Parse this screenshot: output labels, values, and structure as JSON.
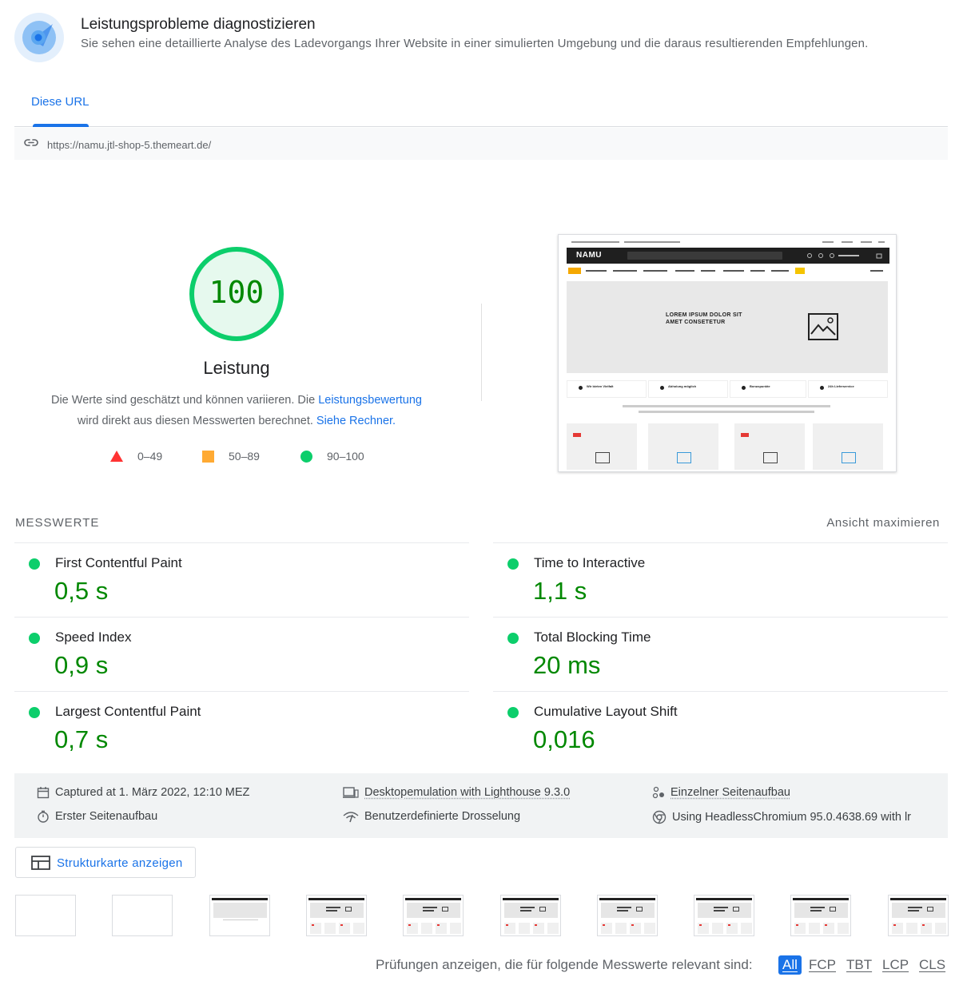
{
  "header": {
    "title": "Leistungsprobleme diagnostizieren",
    "description": "Sie sehen eine detaillierte Analyse des Ladevorgangs Ihrer Website in einer simulierten Umgebung und die daraus resultierenden Empfehlungen.",
    "icon": "lighthouse-gauge-icon"
  },
  "tabs": [
    {
      "label": "Diese URL",
      "active": true
    }
  ],
  "url_bar": {
    "icon": "link-icon",
    "url": "https://namu.jtl-shop-5.themeart.de/"
  },
  "score": {
    "value": "100",
    "fraction": 1.0,
    "label": "Leistung",
    "description_part1": "Die Werte sind geschätzt und können variieren. Die ",
    "description_link1": "Leistungsbewertung",
    "description_part2": "wird direkt aus diesen Messwerten berechnet. ",
    "description_link2": "Siehe Rechner.",
    "color": "#0cce6b",
    "text_color": "#008800"
  },
  "legend": [
    {
      "range": "0–49",
      "shape": "triangle",
      "color": "#ff3333"
    },
    {
      "range": "50–89",
      "shape": "square",
      "color": "#ffaa33"
    },
    {
      "range": "90–100",
      "shape": "circle",
      "color": "#0cce6b"
    }
  ],
  "screenshot": {
    "logo": "NAMU",
    "hero_line1": "LOREM IPSUM DOLOR SIT",
    "hero_line2": "AMET CONSETETUR",
    "features": [
      "Wir bieten Vielfalt",
      "Abholung möglich",
      "Bonuspunkte",
      "24h Lieferservice"
    ]
  },
  "metrics": {
    "title": "MESSWERTE",
    "toggle_label": "Ansicht maximieren",
    "items": [
      {
        "name": "First Contentful Paint",
        "value": "0,5 s",
        "status": "pass"
      },
      {
        "name": "Time to Interactive",
        "value": "1,1 s",
        "status": "pass"
      },
      {
        "name": "Speed Index",
        "value": "0,9 s",
        "status": "pass"
      },
      {
        "name": "Total Blocking Time",
        "value": "20 ms",
        "status": "pass"
      },
      {
        "name": "Largest Contentful Paint",
        "value": "0,7 s",
        "status": "pass"
      },
      {
        "name": "Cumulative Layout Shift",
        "value": "0,016",
        "status": "pass"
      }
    ]
  },
  "environment": {
    "captured": "Captured at 1. März 2022, 12:10 MEZ",
    "device": "Desktopemulation with Lighthouse 9.3.0",
    "session": "Einzelner Seitenaufbau",
    "load_type": "Erster Seitenaufbau",
    "throttling": "Benutzerdefinierte Drosselung",
    "browser": "Using HeadlessChromium 95.0.4638.69 with lr"
  },
  "treemap_button": {
    "label": "Strukturkarte anzeigen",
    "icon": "treemap-icon"
  },
  "filmstrip": {
    "frames": 10
  },
  "filter": {
    "label": "Prüfungen anzeigen, die für folgende Messwerte relevant sind:",
    "chips": [
      "All",
      "FCP",
      "TBT",
      "LCP",
      "CLS"
    ],
    "active": "All"
  }
}
